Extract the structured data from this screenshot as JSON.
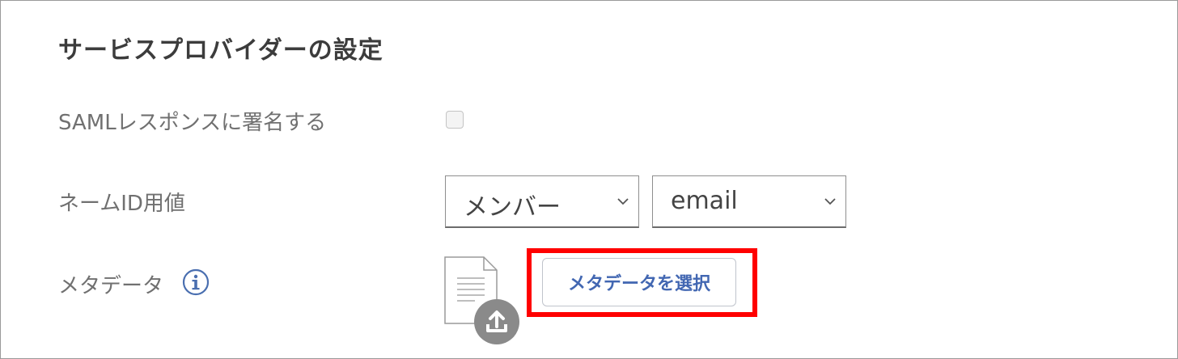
{
  "section": {
    "title": "サービスプロバイダーの設定"
  },
  "saml_signing": {
    "label": "SAMLレスポンスに署名する",
    "checked": false
  },
  "name_id": {
    "label": "ネームID用値",
    "source_value": "メンバー",
    "attribute_value": "email"
  },
  "metadata": {
    "label": "メタデータ",
    "select_button_label": "メタデータを選択"
  },
  "colors": {
    "highlight": "#ff0000",
    "button_text": "#4267b2",
    "info_icon": "#4a6fb0",
    "upload_badge": "#8a8a8a"
  },
  "icons": {
    "info": "info-icon",
    "file": "file-icon",
    "upload": "upload-icon",
    "dropdown": "chevron-down-icon"
  }
}
